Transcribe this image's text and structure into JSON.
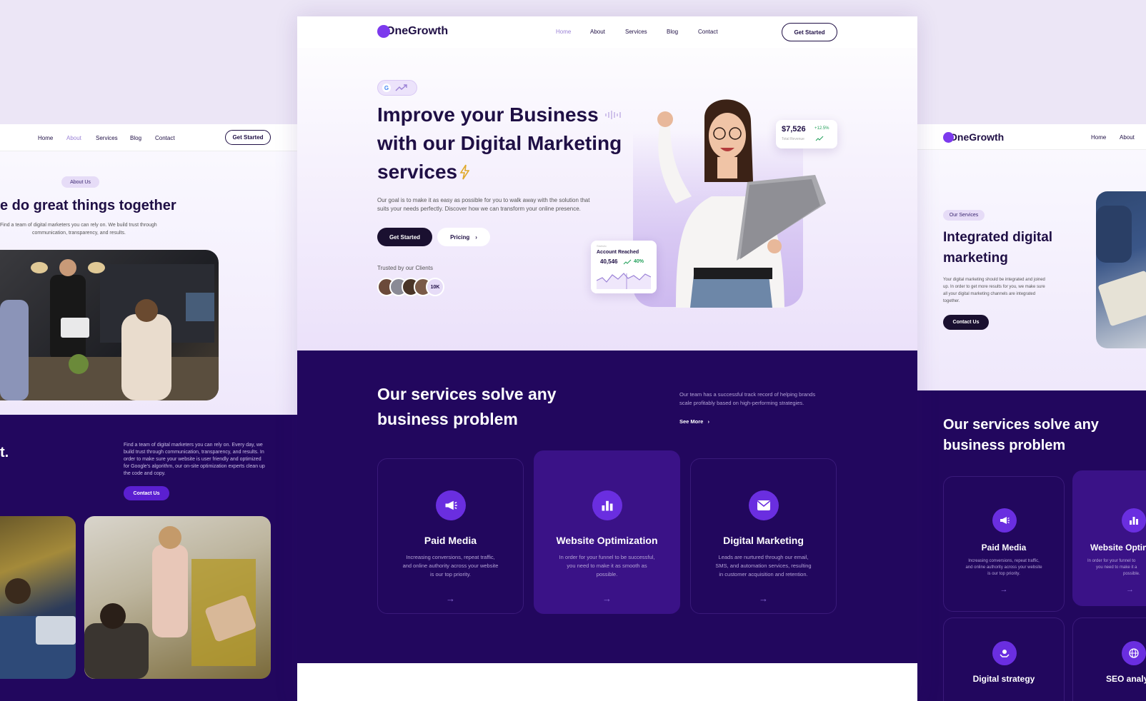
{
  "brand": {
    "name": "OneGrowth",
    "accent": "#5b1fd1",
    "dark": "#22075e"
  },
  "left_panel": {
    "nav": [
      "Home",
      "About",
      "Services",
      "Blog",
      "Contact"
    ],
    "get_started": "Get Started",
    "tag": "About Us",
    "heading": "e do great things together",
    "subtext_lines": [
      "Find a team of digital marketers you can rely on. We build trust through",
      "communication, transparency, and results."
    ],
    "dark_heading": "t.",
    "dark_text_lines": [
      "Find a team of digital marketers you can rely on. Every day, we",
      "build trust through communication, transparency, and results. In",
      "order to make sure your website is user friendly and optimized",
      "for Google's algorithm, our on-site optimization experts clean up",
      "the code and copy."
    ],
    "contact_button": "Contact Us"
  },
  "center_panel": {
    "nav": [
      "Home",
      "About",
      "Services",
      "Blog",
      "Contact"
    ],
    "get_started": "Get Started",
    "hero_lines": [
      "Improve your Business",
      "with our Digital Marketing",
      "services"
    ],
    "hero_desc_lines": [
      "Our goal is to make it as easy as possible for you to walk away with the solution that",
      "suits your needs perfectly. Discover how we can transform your online presence."
    ],
    "cta_primary": "Get Started",
    "cta_secondary": "Pricing",
    "trusted_label": "Trusted by our Clients",
    "clients_count": "10K",
    "revenue_card": {
      "amount": "$7,526",
      "change": "+12.5%",
      "label": "Total Revenue"
    },
    "account_card": {
      "small_label": "Statistic",
      "title": "Account Reached",
      "value": "40,546",
      "change": "40%"
    },
    "services_heading_lines": [
      "Our services solve any",
      "business problem"
    ],
    "services_desc_lines": [
      "Our team has a successful track record of helping brands",
      "scale profitably based on high-performing strategies."
    ],
    "see_more": "See More",
    "services": [
      {
        "title": "Paid Media",
        "icon": "megaphone-icon",
        "lines": [
          "Increasing conversions, repeat traffic,",
          "and online authority across your website",
          "is our top priority."
        ]
      },
      {
        "title": "Website Optimization",
        "icon": "bar-chart-icon",
        "lines": [
          "In order for your funnel to be successful,",
          "you need to make it as smooth as",
          "possible."
        ]
      },
      {
        "title": "Digital Marketing",
        "icon": "mail-icon",
        "lines": [
          "Leads are nurtured through our email,",
          "SMS, and automation services, resulting",
          "in customer acquisition and retention."
        ]
      }
    ]
  },
  "right_panel": {
    "nav": [
      "Home",
      "About"
    ],
    "tag": "Our Services",
    "heading_lines": [
      "Integrated digital",
      "marketing"
    ],
    "text_lines": [
      "Your digital marketing should be integrated and joined",
      "up. In order to get more results for you, we make sure",
      "all your digital marketing channels are integrated",
      "together."
    ],
    "contact_button": "Contact Us",
    "services_heading_lines": [
      "Our services solve any",
      "business problem"
    ],
    "services": [
      {
        "title": "Paid Media",
        "lines": [
          "Increasing conversions, repeat traffic,",
          "and online authority across your website",
          "is our top priority."
        ]
      },
      {
        "title": "Website Optin",
        "lines": [
          "In order for your funnel to",
          "you need to make it a",
          "possible."
        ]
      }
    ],
    "more_services": [
      "Digital strategy",
      "SEO analy"
    ]
  }
}
